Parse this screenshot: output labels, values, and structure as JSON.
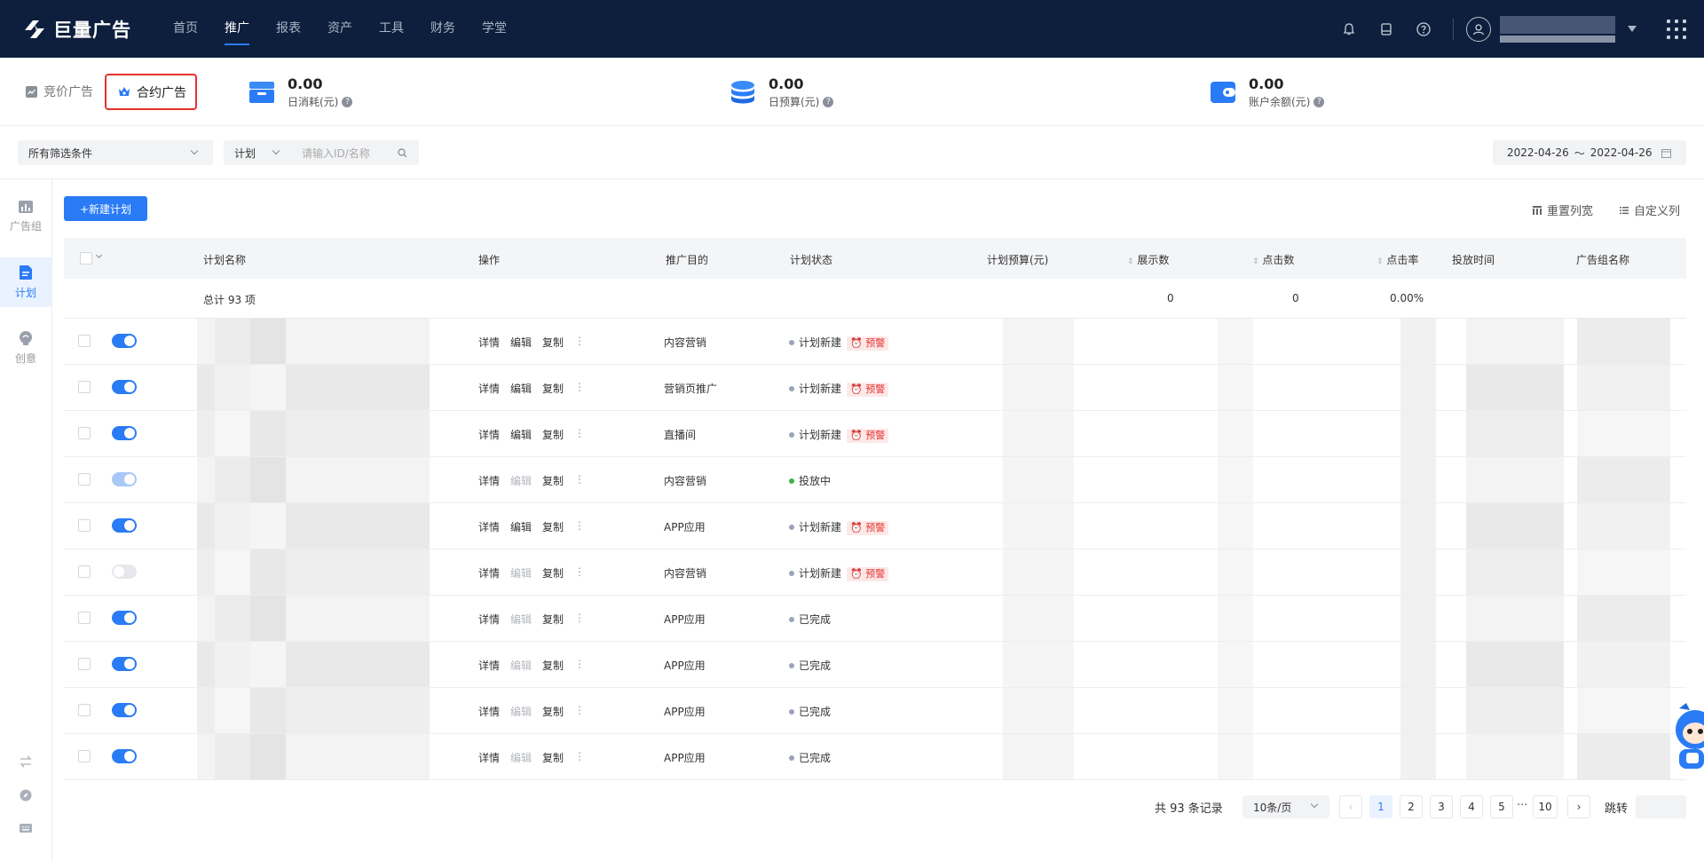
{
  "brand": {
    "name": "巨量广告"
  },
  "nav": [
    {
      "label": "首页",
      "active": false
    },
    {
      "label": "推广",
      "active": true
    },
    {
      "label": "报表",
      "active": false
    },
    {
      "label": "资产",
      "active": false
    },
    {
      "label": "工具",
      "active": false
    },
    {
      "label": "财务",
      "active": false
    },
    {
      "label": "学堂",
      "active": false
    }
  ],
  "top_icons": [
    "bell-icon",
    "tablet-icon",
    "help-icon",
    "user-icon",
    "apps-grid-icon"
  ],
  "adtypes": {
    "bid": "竞价广告",
    "contract": "合约广告"
  },
  "stats": [
    {
      "value": "0.00",
      "label": "日消耗(元)"
    },
    {
      "value": "0.00",
      "label": "日预算(元)"
    },
    {
      "value": "0.00",
      "label": "账户余额(元)"
    }
  ],
  "filters": {
    "condition": "所有筛选条件",
    "scope": "计划",
    "search_placeholder": "请输入ID/名称",
    "date_start": "2022-04-26",
    "date_sep": "～",
    "date_end": "2022-04-26"
  },
  "sidenav": [
    {
      "label": "广告组",
      "icon": "bar-chart-icon",
      "active": false
    },
    {
      "label": "计划",
      "icon": "document-icon",
      "active": true
    },
    {
      "label": "创意",
      "icon": "bulb-icon",
      "active": false
    }
  ],
  "toolbar": {
    "new_plan": "+新建计划",
    "reset_width": "重置列宽",
    "custom_cols": "自定义列"
  },
  "columns": {
    "name": "计划名称",
    "ops": "操作",
    "goal": "推广目的",
    "status": "计划状态",
    "budget": "计划预算(元)",
    "impressions": "展示数",
    "clicks": "点击数",
    "ctr": "点击率",
    "time": "投放时间",
    "group": "广告组名称"
  },
  "total": {
    "label": "总计 93 项",
    "impressions": "0",
    "clicks": "0",
    "ctr": "0.00%"
  },
  "ops_labels": {
    "detail": "详情",
    "edit": "编辑",
    "copy": "复制",
    "more": "⋮"
  },
  "warn_label": "预警",
  "rows": [
    {
      "switch": "on",
      "edit_enabled": true,
      "goal": "内容营销",
      "status": "计划新建",
      "warn": true
    },
    {
      "switch": "on",
      "edit_enabled": true,
      "goal": "营销页推广",
      "status": "计划新建",
      "warn": true
    },
    {
      "switch": "on",
      "edit_enabled": true,
      "goal": "直播间",
      "status": "计划新建",
      "warn": true
    },
    {
      "switch": "light",
      "edit_enabled": false,
      "goal": "内容营销",
      "status": "投放中",
      "warn": false
    },
    {
      "switch": "on",
      "edit_enabled": true,
      "goal": "APP应用",
      "status": "计划新建",
      "warn": true
    },
    {
      "switch": "off",
      "edit_enabled": false,
      "goal": "内容营销",
      "status": "计划新建",
      "warn": true
    },
    {
      "switch": "on",
      "edit_enabled": false,
      "goal": "APP应用",
      "status": "已完成",
      "warn": false
    },
    {
      "switch": "on",
      "edit_enabled": false,
      "goal": "APP应用",
      "status": "已完成",
      "warn": false
    },
    {
      "switch": "on",
      "edit_enabled": false,
      "goal": "APP应用",
      "status": "已完成",
      "warn": false
    },
    {
      "switch": "on",
      "edit_enabled": false,
      "goal": "APP应用",
      "status": "已完成",
      "warn": false
    }
  ],
  "pagination": {
    "total_text": "共 93 条记录",
    "page_size": "10条/页",
    "pages": [
      "1",
      "2",
      "3",
      "4",
      "5",
      "···",
      "10"
    ],
    "current": "1",
    "jump_label": "跳转"
  }
}
